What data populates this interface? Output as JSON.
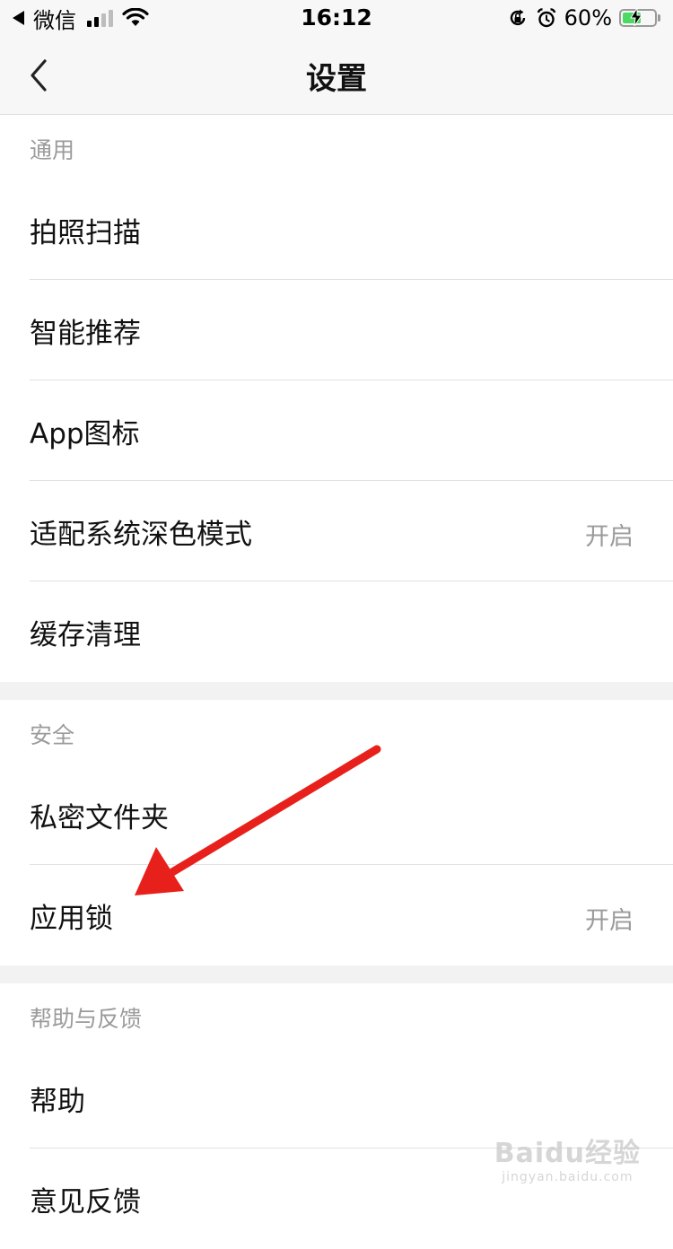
{
  "status_bar": {
    "back_app": "微信",
    "time": "16:12",
    "battery": "60%",
    "battery_level": 0.6,
    "icons": [
      "signal-icon",
      "wifi-icon",
      "rotation-lock-icon",
      "alarm-icon",
      "battery-icon"
    ]
  },
  "navbar": {
    "title": "设置",
    "back_icon": "chevron-left-icon"
  },
  "sections": {
    "general": {
      "header": "通用",
      "items": [
        {
          "label": "拍照扫描",
          "value": ""
        },
        {
          "label": "智能推荐",
          "value": ""
        },
        {
          "label": "App图标",
          "value": ""
        },
        {
          "label": "适配系统深色模式",
          "value": "开启"
        },
        {
          "label": "缓存清理",
          "value": ""
        }
      ]
    },
    "security": {
      "header": "安全",
      "items": [
        {
          "label": "私密文件夹",
          "value": ""
        },
        {
          "label": "应用锁",
          "value": "开启"
        }
      ]
    },
    "help": {
      "header": "帮助与反馈",
      "items": [
        {
          "label": "帮助",
          "value": ""
        },
        {
          "label": "意见反馈",
          "value": ""
        }
      ]
    }
  },
  "annotation": {
    "arrow_color": "#e8201c"
  },
  "watermark": {
    "main": "Baidu经验",
    "sub": "jingyan.baidu.com"
  },
  "colors": {
    "bar_bg": "#f7f7f7",
    "section_gap": "#f2f2f2",
    "secondary_text": "#9b9b9b",
    "battery_green": "#4cd964"
  }
}
